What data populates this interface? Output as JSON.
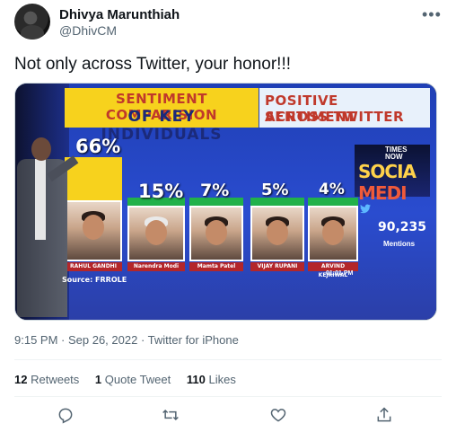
{
  "user": {
    "display_name": "Dhivya Marunthiah",
    "handle": "@DhivCM"
  },
  "tweet": {
    "text": "Not only across Twitter, your honor!!!",
    "time": "9:15 PM",
    "date": "Sep 26, 2022",
    "via": "Twitter for iPhone"
  },
  "media": {
    "title_line1": "SENTIMENT COMPARISION",
    "title_line2": "OF KEY INDIVIDUALS",
    "subtitle_line1": "POSITIVE SENTIMENT",
    "subtitle_line2": "ACROSS TWITTER",
    "source": "Source: FRROLE",
    "timestamp": "01:01 PM",
    "twitter_count": "90,235",
    "mentions_label": "Mentions",
    "channel_times": "TIMES",
    "channel_now": "NOW",
    "channel_social": "SOCIA",
    "channel_media": "MEDI",
    "colors": {
      "title_bg": "#f7d21d",
      "bar_top": "#f7d21d",
      "bar_rest": "#21b14a",
      "name_strip": "#b3262a",
      "background": "#2a4ccf"
    }
  },
  "chart_data": {
    "type": "bar",
    "title": "SENTIMENT COMPARISION OF KEY INDIVIDUALS",
    "subtitle": "POSITIVE SENTIMENT ACROSS TWITTER",
    "categories": [
      "RAHUL GANDHI",
      "Narendra Modi",
      "Mamta Patel",
      "VIJAY RUPANI",
      "ARVIND KEJRIWAL"
    ],
    "values": [
      66,
      15,
      7,
      5,
      4
    ],
    "value_labels": [
      "66%",
      "15%",
      "7%",
      "5%",
      "4%"
    ],
    "ylim": [
      0,
      100
    ]
  },
  "stats": {
    "retweets": "12",
    "retweets_label": "Retweets",
    "quotes": "1",
    "quotes_label": "Quote Tweet",
    "likes": "110",
    "likes_label": "Likes"
  },
  "icons": [
    "more-icon",
    "reply-icon",
    "retweet-icon",
    "like-icon",
    "share-icon",
    "twitter-bird-icon"
  ]
}
